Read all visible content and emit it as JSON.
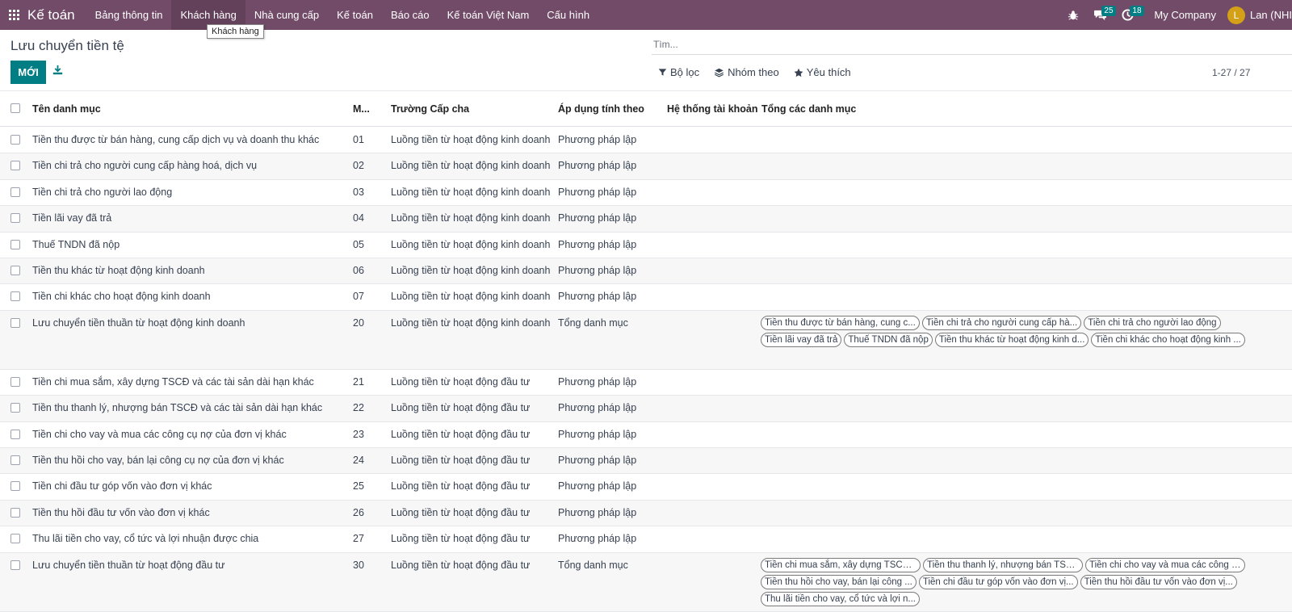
{
  "navbar": {
    "brand": "Kế toán",
    "menu": [
      "Bảng thông tin",
      "Khách hàng",
      "Nhà cung cấp",
      "Kế toán",
      "Báo cáo",
      "Kế toán Việt Nam",
      "Cấu hình"
    ],
    "messages_count": "25",
    "activities_count": "18",
    "company": "My Company",
    "user_initial": "L",
    "user_name": "Lan (NHI",
    "bar_color": "#714b67",
    "badge_color": "#017e84"
  },
  "tooltip": "Khách hàng",
  "control_panel": {
    "title": "Lưu chuyển tiền tệ",
    "new_button": "MỚI",
    "search_placeholder": "Tìm...",
    "filter": "Bộ lọc",
    "group_by": "Nhóm theo",
    "favorites": "Yêu thích",
    "pager": "1-27 / 27"
  },
  "table": {
    "columns": [
      "Tên danh mục",
      "M...",
      "Trường Cấp cha",
      "Áp dụng tính theo",
      "Hệ thống tài khoản",
      "Tổng các danh mục"
    ],
    "rows": [
      {
        "name": "Tiền thu được từ bán hàng, cung cấp dịch vụ và doanh thu khác",
        "code": "01",
        "parent": "Luồng tiền từ hoạt động kinh doanh",
        "method": "Phương pháp lập",
        "tags": []
      },
      {
        "name": "Tiền chi trả cho người cung cấp hàng hoá, dịch vụ",
        "code": "02",
        "parent": "Luồng tiền từ hoạt động kinh doanh",
        "method": "Phương pháp lập",
        "tags": []
      },
      {
        "name": "Tiền chi trả cho người lao động",
        "code": "03",
        "parent": "Luồng tiền từ hoạt động kinh doanh",
        "method": "Phương pháp lập",
        "tags": []
      },
      {
        "name": "Tiền lãi vay đã trả",
        "code": "04",
        "parent": "Luồng tiền từ hoạt động kinh doanh",
        "method": "Phương pháp lập",
        "tags": []
      },
      {
        "name": "Thuế TNDN đã nộp",
        "code": "05",
        "parent": "Luồng tiền từ hoạt động kinh doanh",
        "method": "Phương pháp lập",
        "tags": []
      },
      {
        "name": "Tiền thu khác từ hoạt động kinh doanh",
        "code": "06",
        "parent": "Luồng tiền từ hoạt động kinh doanh",
        "method": "Phương pháp lập",
        "tags": []
      },
      {
        "name": "Tiền chi khác cho hoạt động kinh doanh",
        "code": "07",
        "parent": "Luồng tiền từ hoạt động kinh doanh",
        "method": "Phương pháp lập",
        "tags": []
      },
      {
        "name": "Lưu chuyển tiền thuần từ hoạt động kinh doanh",
        "code": "20",
        "parent": "Luồng tiền từ hoạt động kinh doanh",
        "method": "Tổng danh mục",
        "tags": [
          "Tiền thu được từ bán hàng, cung c...",
          "Tiền chi trả cho người cung cấp hà...",
          "Tiền chi trả cho người lao động",
          "Tiền lãi vay đã trả",
          "Thuế TNDN đã nộp",
          "Tiền thu khác từ hoạt động kinh d...",
          "Tiền chi khác cho hoạt động kinh ..."
        ]
      },
      {
        "name": "Tiền chi mua sắm, xây dựng TSCĐ và các tài sản dài hạn khác",
        "code": "21",
        "parent": "Luồng tiền từ hoạt động đầu tư",
        "method": "Phương pháp lập",
        "tags": []
      },
      {
        "name": "Tiền thu thanh lý, nhượng bán TSCĐ và các tài sản dài hạn khác",
        "code": "22",
        "parent": "Luồng tiền từ hoạt động đầu tư",
        "method": "Phương pháp lập",
        "tags": []
      },
      {
        "name": "Tiền chi cho vay và mua các công cụ nợ của đơn vị khác",
        "code": "23",
        "parent": "Luồng tiền từ hoạt động đầu tư",
        "method": "Phương pháp lập",
        "tags": []
      },
      {
        "name": "Tiền thu hồi cho vay, bán lại công cụ nợ của đơn vị khác",
        "code": "24",
        "parent": "Luồng tiền từ hoạt động đầu tư",
        "method": "Phương pháp lập",
        "tags": []
      },
      {
        "name": "Tiền chi đầu tư góp vốn vào đơn vị khác",
        "code": "25",
        "parent": "Luồng tiền từ hoạt động đầu tư",
        "method": "Phương pháp lập",
        "tags": []
      },
      {
        "name": "Tiền thu hồi đầu tư vốn vào đơn vị khác",
        "code": "26",
        "parent": "Luồng tiền từ hoạt động đầu tư",
        "method": "Phương pháp lập",
        "tags": []
      },
      {
        "name": "Thu lãi tiền cho vay, cổ tức và lợi nhuận được chia",
        "code": "27",
        "parent": "Luồng tiền từ hoạt động đầu tư",
        "method": "Phương pháp lập",
        "tags": []
      },
      {
        "name": "Lưu chuyển tiền thuần từ hoạt động đầu tư",
        "code": "30",
        "parent": "Luồng tiền từ hoạt động đầu tư",
        "method": "Tổng danh mục",
        "tags": [
          "Tiền chi mua sắm, xây dựng TSCĐ ...",
          "Tiền thu thanh lý, nhượng bán TSC...",
          "Tiền chi cho vay và mua các công c...",
          "Tiền thu hồi cho vay, bán lại công ...",
          "Tiền chi đầu tư góp vốn vào đơn vị...",
          "Tiền thu hồi đầu tư vốn vào đơn vị...",
          "Thu lãi tiền cho vay, cổ tức và lợi n..."
        ]
      }
    ]
  }
}
